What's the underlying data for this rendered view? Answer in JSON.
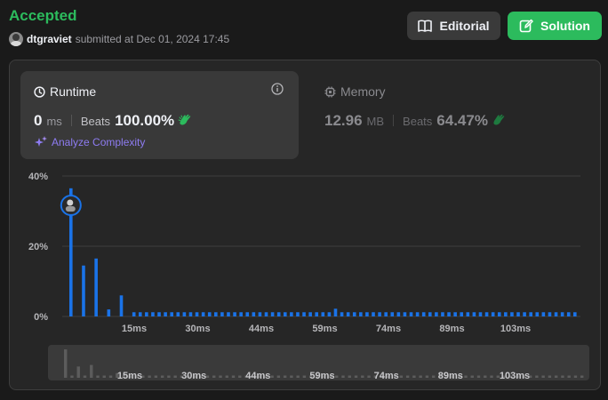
{
  "header": {
    "status": "Accepted",
    "username": "dtgraviet",
    "submitted_text": "submitted at Dec 01, 2024 17:45",
    "editorial_label": "Editorial",
    "solution_label": "Solution"
  },
  "runtime": {
    "title": "Runtime",
    "value": "0",
    "unit": "ms",
    "beats_label": "Beats",
    "beats_value": "100.00%",
    "analyze_label": "Analyze Complexity"
  },
  "memory": {
    "title": "Memory",
    "value": "12.96",
    "unit": "MB",
    "beats_label": "Beats",
    "beats_value": "64.47%"
  },
  "colors": {
    "accepted": "#2cbb5d",
    "bar": "#1a73e8",
    "analyze": "#8e7cf2",
    "navigator_bar": "#5c5c5c"
  },
  "chart_data": {
    "type": "bar",
    "ylim": [
      0,
      40
    ],
    "yticks": [
      "40%",
      "20%",
      "0%"
    ],
    "xticks": [
      "15ms",
      "30ms",
      "44ms",
      "59ms",
      "74ms",
      "89ms",
      "103ms"
    ],
    "grid": true,
    "highlight_index": 0,
    "values": [
      36.5,
      0,
      14.5,
      0,
      16.5,
      0,
      2,
      0,
      6,
      0,
      1.2,
      1.2,
      1.2,
      1.2,
      1.2,
      1.2,
      1.2,
      1.2,
      1.2,
      1.2,
      1.2,
      1.2,
      1.2,
      1.2,
      1.2,
      1.2,
      1.2,
      1.2,
      1.2,
      1.2,
      1.2,
      1.2,
      1.2,
      1.2,
      1.2,
      1.2,
      1.2,
      1.2,
      1.2,
      1.2,
      1.2,
      1.2,
      2.2,
      1.2,
      1.2,
      1.2,
      1.2,
      1.2,
      1.2,
      1.2,
      1.2,
      1.2,
      1.2,
      1.2,
      1.2,
      1.2,
      1.2,
      1.2,
      1.2,
      1.2,
      1.2,
      1.2,
      1.2,
      1.2,
      1.2,
      1.2,
      1.2,
      1.2,
      1.2,
      1.2,
      1.2,
      1.2,
      1.2,
      1.2,
      1.2,
      1.2,
      1.2,
      1.2,
      1.2,
      1.2,
      1.2
    ]
  }
}
